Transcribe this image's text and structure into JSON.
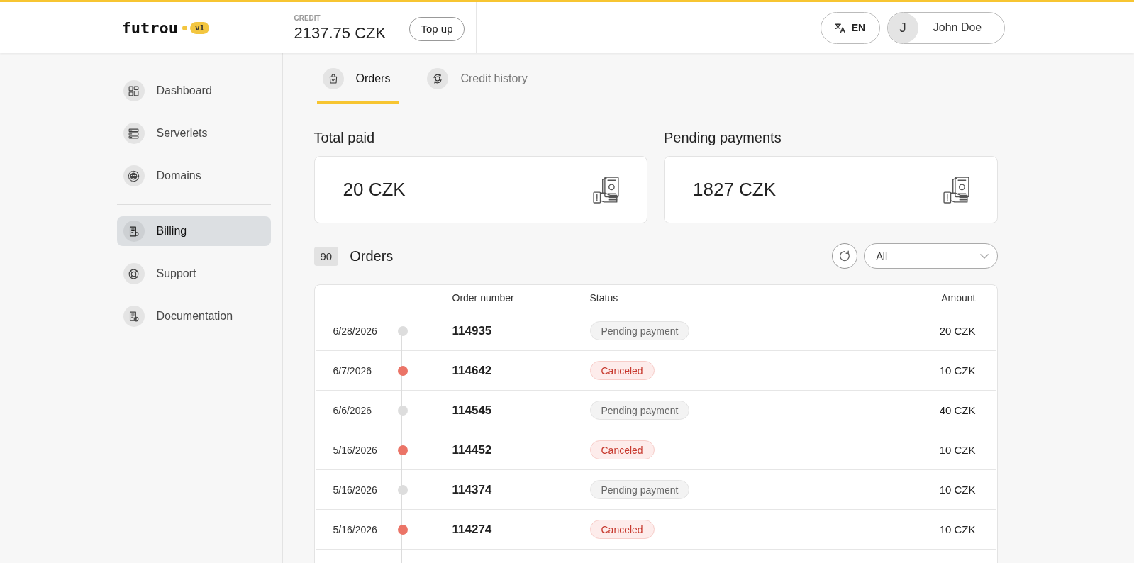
{
  "header": {
    "logo": "futrou",
    "version": "v1",
    "credit": {
      "label": "CREDIT",
      "amount": "2137.75 CZK"
    },
    "top_up_button": "Top up",
    "language_button": "EN",
    "user": {
      "initial": "J",
      "name": "John Doe"
    }
  },
  "sidebar": {
    "groups": [
      {
        "items": [
          {
            "label": "Dashboard",
            "selected": false
          },
          {
            "label": "Serverlets",
            "selected": false
          },
          {
            "label": "Domains",
            "selected": false
          }
        ]
      },
      {
        "items": [
          {
            "label": "Billing",
            "selected": true
          },
          {
            "label": "Support",
            "selected": false
          },
          {
            "label": "Documentation",
            "selected": false
          }
        ]
      }
    ]
  },
  "tabs": [
    {
      "label": "Orders",
      "selected": true
    },
    {
      "label": "Credit history",
      "selected": false
    }
  ],
  "summary_cards": [
    {
      "title": "Total paid",
      "value": "20 CZK"
    },
    {
      "title": "Pending payments",
      "value": "1827 CZK"
    }
  ],
  "orders": {
    "count": "90",
    "title": "Orders",
    "filter": {
      "value": "All"
    },
    "table": {
      "columns": [
        "Order number",
        "Status",
        "Amount"
      ],
      "rows": [
        {
          "date": "6/28/2026",
          "color": "#dddddd",
          "order_number": "114935",
          "kind": "pending",
          "status": "Pending payment",
          "amount": "20 CZK"
        },
        {
          "date": "6/7/2026",
          "color": "#eb7467",
          "order_number": "114642",
          "kind": "canceled",
          "status": "Canceled",
          "amount": "10 CZK"
        },
        {
          "date": "6/6/2026",
          "color": "#dddddd",
          "order_number": "114545",
          "kind": "pending",
          "status": "Pending payment",
          "amount": "40 CZK"
        },
        {
          "date": "5/16/2026",
          "color": "#eb7467",
          "order_number": "114452",
          "kind": "canceled",
          "status": "Canceled",
          "amount": "10 CZK"
        },
        {
          "date": "5/16/2026",
          "color": "#dddddd",
          "order_number": "114374",
          "kind": "pending",
          "status": "Pending payment",
          "amount": "10 CZK"
        },
        {
          "date": "5/16/2026",
          "color": "#eb7467",
          "order_number": "114274",
          "kind": "canceled",
          "status": "Canceled",
          "amount": "10 CZK"
        }
      ]
    }
  }
}
